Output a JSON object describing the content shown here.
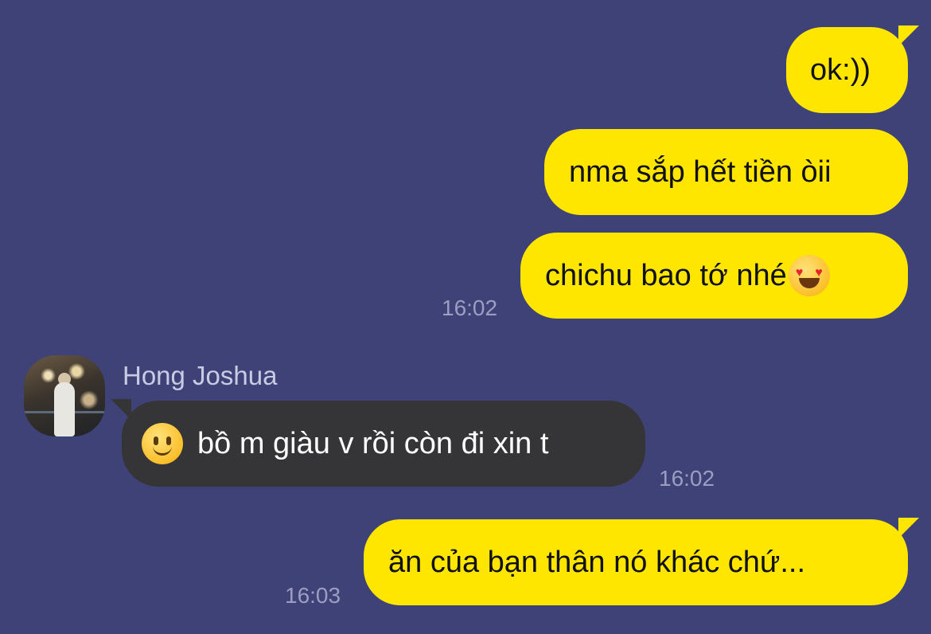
{
  "messages": [
    {
      "text": "ok:))"
    },
    {
      "text": "nma sắp hết tiền òii"
    },
    {
      "text": "chichu bao tớ nhé",
      "emoji": "heart-eyes-emoji",
      "time": "16:02"
    },
    {
      "sender": "Hong Joshua",
      "text": "bồ m giàu v rồi còn đi xin t",
      "emoji": "slightly-smiling-emoji",
      "time": "16:02"
    },
    {
      "text": "ăn của bạn thân nó khác chứ...",
      "time": "16:03"
    }
  ],
  "colors": {
    "background": "#3f4276",
    "outgoing_bubble": "#ffe600",
    "incoming_bubble": "#353537",
    "timestamp": "#9b9ec2"
  }
}
